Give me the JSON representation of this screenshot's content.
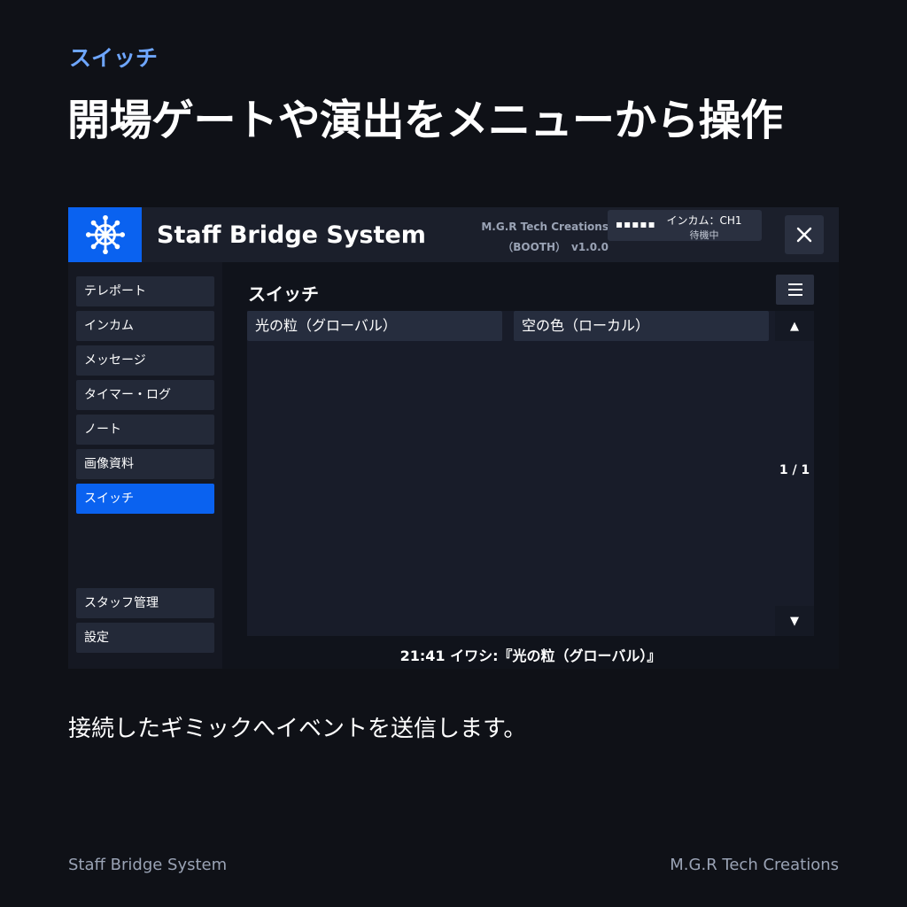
{
  "header": {
    "eyebrow": "スイッチ",
    "headline": "開場ゲートや演出をメニューから操作"
  },
  "window": {
    "app_title": "Staff Bridge System",
    "vendor_line1": "M.G.R Tech Creations",
    "vendor_line2": "（BOOTH）　v1.0.0",
    "intercom": {
      "signal": "▪▪▪▪▪",
      "channel": "インカム：CH1",
      "status": "待機中"
    },
    "close_label": "✕",
    "logo_icon": "ship-wheel-icon",
    "accent_color": "#0a62f0"
  },
  "sidebar": {
    "items": [
      {
        "label": "テレポート"
      },
      {
        "label": "インカム"
      },
      {
        "label": "メッセージ"
      },
      {
        "label": "タイマー・ログ"
      },
      {
        "label": "ノート"
      },
      {
        "label": "画像資料"
      },
      {
        "label": "スイッチ",
        "active": true
      }
    ],
    "bottom_items": [
      {
        "label": "スタッフ管理"
      },
      {
        "label": "設定"
      }
    ]
  },
  "main": {
    "section_title": "スイッチ",
    "menu_icon": "hamburger-icon",
    "switches": [
      {
        "label": "光の粒（グローバル）"
      },
      {
        "label": "空の色（ローカル）"
      }
    ],
    "scroll_up": "▲",
    "scroll_down": "▼",
    "page_indicator": "1 / 1",
    "log": "21:41 イワシ:『光の粒（グローバル）』"
  },
  "caption": "接続したギミックへイベントを送信します。",
  "footer": {
    "left": "Staff Bridge System",
    "right": "M.G.R Tech Creations"
  }
}
